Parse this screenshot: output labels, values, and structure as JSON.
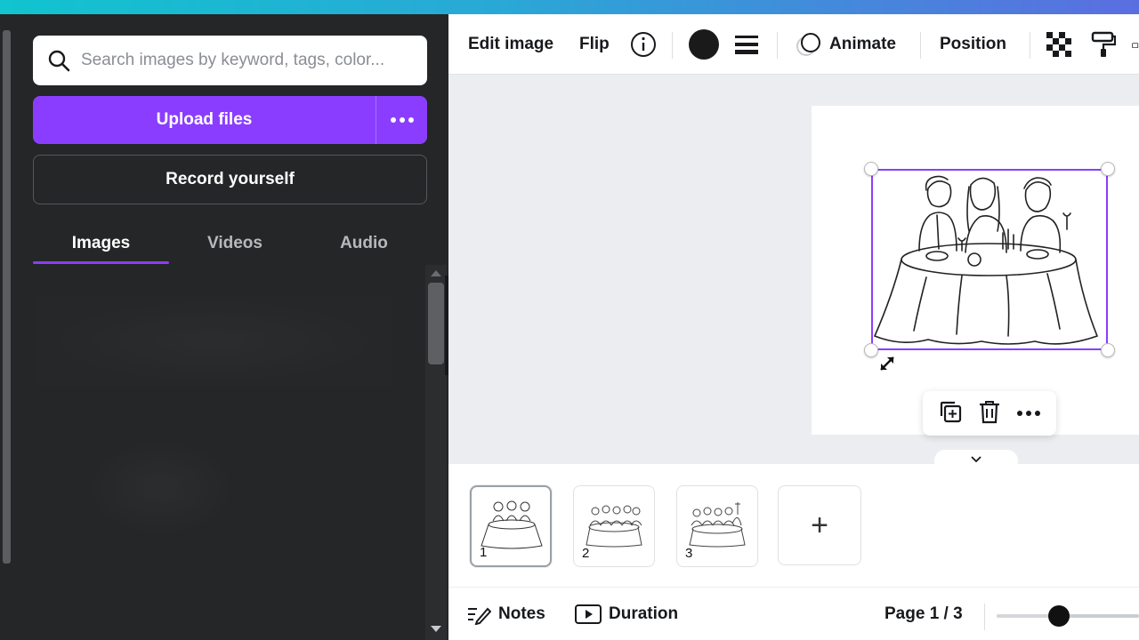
{
  "panel": {
    "search_placeholder": "Search images by keyword, tags, color...",
    "upload_label": "Upload files",
    "record_label": "Record yourself",
    "tabs": [
      {
        "label": "Images",
        "active": true
      },
      {
        "label": "Videos",
        "active": false
      },
      {
        "label": "Audio",
        "active": false
      }
    ]
  },
  "toolbar": {
    "edit_image": "Edit image",
    "flip": "Flip",
    "animate": "Animate",
    "position": "Position",
    "color": "#1a1a1a"
  },
  "pages": {
    "thumbs": [
      {
        "number": "1",
        "active": true
      },
      {
        "number": "2",
        "active": false
      },
      {
        "number": "3",
        "active": false
      }
    ],
    "add_label": "+"
  },
  "footer": {
    "notes": "Notes",
    "duration": "Duration",
    "page_indicator": "Page 1 / 3"
  },
  "colors": {
    "accent": "#8b3dff"
  }
}
